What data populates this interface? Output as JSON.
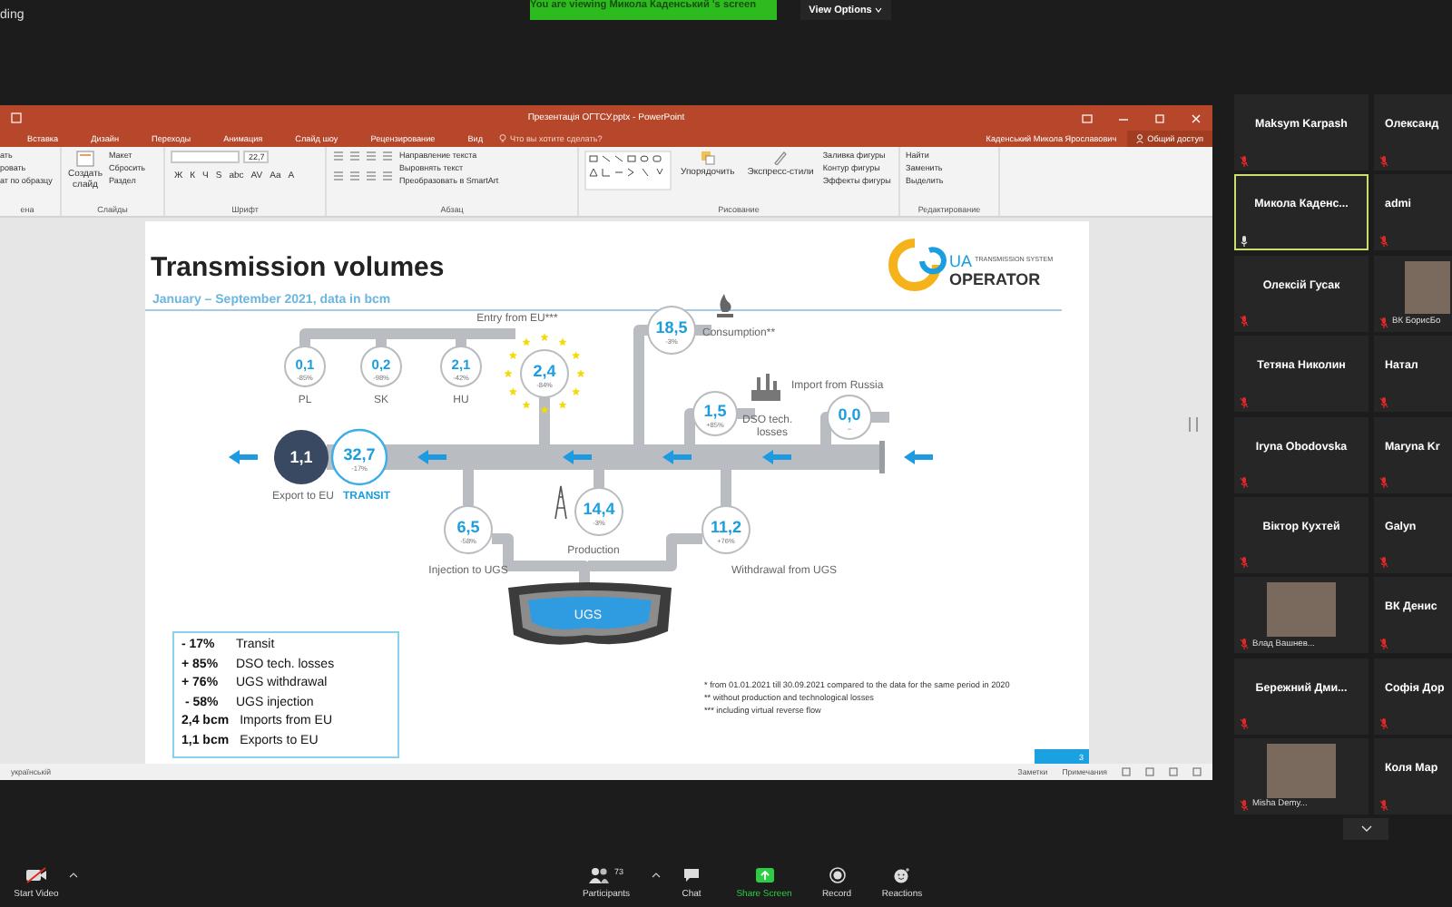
{
  "top_bar": {
    "recording_label": "ding",
    "banner": "You are viewing Микола Каденський 's screen",
    "view_options": "View Options"
  },
  "powerpoint": {
    "title": "Презентація ОГТСУ.pptx - PowerPoint",
    "tabs": [
      "Вставка",
      "Дизайн",
      "Переходы",
      "Анимация",
      "Слайд шоу",
      "Рецензирование",
      "Вид"
    ],
    "tell_me": "Что вы хотите сделать?",
    "user": "Каденський Микола Ярославович",
    "share": "Общий доступ",
    "ribbon": {
      "clipboard_items": [
        "ать",
        "ровать",
        "ат по образцу"
      ],
      "clipboard_group": "ена",
      "new_slide": "Создать слайд",
      "slide_items": [
        "Макет",
        "Сбросить",
        "Раздел"
      ],
      "slides_group": "Слайды",
      "font_size": "22,7",
      "font_buttons": [
        "Ж",
        "К",
        "Ч",
        "S",
        "abc",
        "AV",
        "Aa",
        "A"
      ],
      "font_group": "Шрифт",
      "paragraph_items": [
        "Направление текста",
        "Выровнять текст",
        "Преобразовать в SmartArt"
      ],
      "paragraph_group": "Абзац",
      "arrange": "Упорядочить",
      "quick_styles": "Экспресс-стили",
      "shape_items": [
        "Заливка фигуры",
        "Контур фигуры",
        "Эффекты фигуры"
      ],
      "drawing_group": "Рисование",
      "editing_items": [
        "Найти",
        "Заменить",
        "Выделить"
      ],
      "editing_group": "Редактирование"
    },
    "slide": {
      "title": "Transmission volumes",
      "subtitle": "January – September 2021, data in bcm",
      "logo": {
        "prefix": "UA",
        "tagline": "TRANSMISSION SYSTEM",
        "name": "OPERATOR"
      },
      "nodes": [
        {
          "kind": "branch",
          "value": "0,1",
          "change": "-85%",
          "label": "PL"
        },
        {
          "kind": "branch",
          "value": "0,2",
          "change": "-98%",
          "label": "SK"
        },
        {
          "kind": "branch",
          "value": "2,1",
          "change": "-42%",
          "label": "HU"
        },
        {
          "kind": "entry",
          "value": "2,4",
          "change": "-84%",
          "label": "Entry from EU***"
        },
        {
          "kind": "export",
          "value": "1,1",
          "label": "Export to EU"
        },
        {
          "kind": "transit",
          "value": "32,7",
          "change": "-17%",
          "label": "TRANSIT"
        },
        {
          "kind": "node",
          "value": "18,5",
          "change": "-3%",
          "label": "Consumption**"
        },
        {
          "kind": "node",
          "value": "1,5",
          "change": "+85%",
          "label": "DSO tech. losses"
        },
        {
          "kind": "node",
          "value": "0,0",
          "change": "–",
          "label": "Import from Russia"
        },
        {
          "kind": "node",
          "value": "6,5",
          "change": "-58%",
          "label": "Injection to UGS"
        },
        {
          "kind": "node",
          "value": "14,4",
          "change": "-3%",
          "label": "Production"
        },
        {
          "kind": "node",
          "value": "11,2",
          "change": "+76%",
          "label": "Withdrawal from UGS"
        }
      ],
      "storage_label": "UGS",
      "summary": [
        {
          "figure": "- 17%",
          "text": "Transit"
        },
        {
          "figure": "+ 85%",
          "text": "DSO tech. losses"
        },
        {
          "figure": "+ 76%",
          "text": "UGS withdrawal"
        },
        {
          "figure": " - 58%",
          "text": "UGS injection"
        },
        {
          "figure": "2,4 bcm",
          "text": "Imports from EU"
        },
        {
          "figure": "1,1 bcm",
          "text": "Exports to EU"
        }
      ],
      "footnotes": [
        "* from  01.01.2021 till 30.09.2021 compared to the data for the same period in 2020",
        "** without production and technological losses",
        "*** including virtual reverse flow"
      ],
      "page_number": "3"
    },
    "status_bar": {
      "language": "українській",
      "notes": "Заметки",
      "comments": "Примечания"
    }
  },
  "participants": [
    {
      "name": "Maksym Karpash",
      "kind": "name",
      "muted": true,
      "active_speaker": false
    },
    {
      "name": "Олександ",
      "kind": "name",
      "muted": true,
      "active_speaker": false
    },
    {
      "name": "Микола  Каденс...",
      "kind": "name",
      "muted": false,
      "active_speaker": true
    },
    {
      "name": "admi",
      "kind": "name",
      "muted": true,
      "active_speaker": false
    },
    {
      "name": "Олексій Гусак",
      "kind": "name",
      "muted": true,
      "active_speaker": false
    },
    {
      "name": "ВК БорисБо",
      "kind": "photo",
      "muted": true,
      "active_speaker": false
    },
    {
      "name": "Тетяна Николин",
      "kind": "name",
      "muted": true,
      "active_speaker": false
    },
    {
      "name": "Натал",
      "kind": "name",
      "muted": true,
      "active_speaker": false
    },
    {
      "name": "Iryna Obodovska",
      "kind": "name",
      "muted": true,
      "active_speaker": false
    },
    {
      "name": "Maryna Kr",
      "kind": "name",
      "muted": true,
      "active_speaker": false
    },
    {
      "name": "Віктор Кухтей",
      "kind": "name",
      "muted": true,
      "active_speaker": false
    },
    {
      "name": "Galyn",
      "kind": "name",
      "muted": true,
      "active_speaker": false
    },
    {
      "name": "Влад Вашнев...",
      "kind": "photo",
      "muted": true,
      "active_speaker": false
    },
    {
      "name": "ВК Денис",
      "kind": "name",
      "muted": true,
      "active_speaker": false
    },
    {
      "name": "Бережний Дми...",
      "kind": "name",
      "muted": true,
      "active_speaker": false
    },
    {
      "name": "Софія Дор",
      "kind": "name",
      "muted": true,
      "active_speaker": false
    },
    {
      "name": "Misha Demy...",
      "kind": "photo",
      "muted": true,
      "active_speaker": false
    },
    {
      "name": "Коля Мар",
      "kind": "name",
      "muted": true,
      "active_speaker": false
    }
  ],
  "toolbar": {
    "video_on": false,
    "start_video": "Start Video",
    "participants": "Participants",
    "participant_count": "73",
    "chat": "Chat",
    "share_screen": "Share Screen",
    "record": "Record",
    "reactions": "Reactions"
  }
}
